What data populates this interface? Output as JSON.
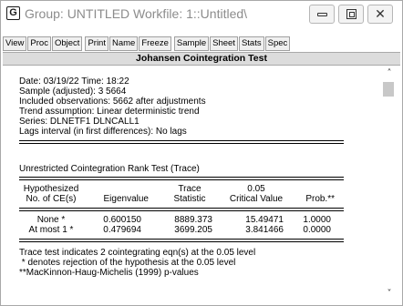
{
  "window": {
    "app_icon": "G",
    "title": "Group: UNTITLED   Workfile: 1::Untitled\\"
  },
  "toolbar": {
    "buttons": [
      "View",
      "Proc",
      "Object",
      "Print",
      "Name",
      "Freeze",
      "Sample",
      "Sheet",
      "Stats",
      "Spec"
    ]
  },
  "view_header": "Johansen Cointegration Test",
  "info": {
    "lines": [
      "Date: 03/19/22   Time: 18:22",
      "Sample (adjusted): 3 5664",
      "Included observations: 5662 after adjustments",
      "Trend assumption: Linear deterministic trend",
      "Series: DLNETF1 DLNCALL1",
      "Lags interval (in first differences): No lags"
    ]
  },
  "trace_test": {
    "title": "Unrestricted Cointegration Rank Test (Trace)",
    "headers": {
      "hyp_1": "Hypothesized",
      "hyp_2": "No. of CE(s)",
      "eig": "Eigenvalue",
      "stat_1": "Trace",
      "stat_2": "Statistic",
      "cv_1": "0.05",
      "cv_2": "Critical Value",
      "prob": "Prob.**"
    },
    "rows": [
      {
        "hyp": "None *",
        "eig": "0.600150",
        "stat": "8889.373",
        "cv": "15.49471",
        "prob": "1.0000"
      },
      {
        "hyp": "At most 1 *",
        "eig": "0.479694",
        "stat": "3699.205",
        "cv": "3.841466",
        "prob": "0.0000"
      }
    ],
    "notes": [
      "Trace test indicates 2 cointegrating eqn(s) at the 0.05 level",
      " * denotes rejection of the hypothesis at the 0.05 level",
      "**MacKinnon-Haug-Michelis (1999) p-values"
    ]
  },
  "icons": {
    "minimize": "minimize-icon",
    "maximize": "maximize-icon",
    "close": "close-icon",
    "scroll_up": "˄",
    "scroll_down": "˅",
    "close_glyph": "✕"
  },
  "colors": {
    "header_band": "#dcdcdc",
    "title_text": "#8c8c8c"
  }
}
